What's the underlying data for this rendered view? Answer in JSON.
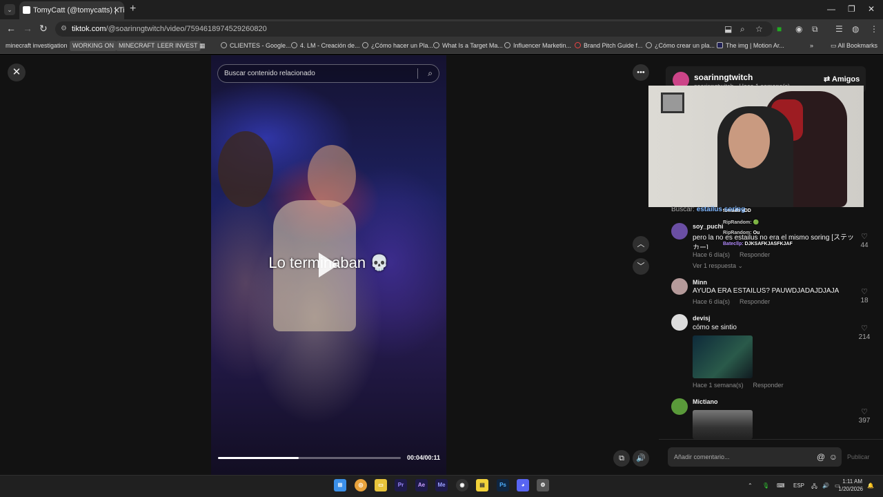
{
  "browser": {
    "tab_title": "TomyCatt (@tomycatts) | TikTok",
    "url_domain": "tiktok.com",
    "url_path": "/@soarinngtwitch/video/7594618974529260820",
    "bookmarks": [
      "minecraft investigation",
      "WORKING ON",
      "MINECRAFT",
      "LEER INVEST",
      "CLIENTES - Google...",
      "4. LM - Creación de...",
      "¿Cómo hacer un Pla...",
      "What Is a Target Ma...",
      "Influencer Marketin...",
      "Brand Pitch Guide f...",
      "¿Cómo crear un pla...",
      "The img | Motion Ar..."
    ],
    "all_bookmarks": "All Bookmarks"
  },
  "video": {
    "search_placeholder": "Buscar contenido relacionado",
    "caption": "Lo terminaban 💀",
    "time": "00:04/00:11",
    "progress_fraction": 0.44
  },
  "author": {
    "name": "soarinngtwitch",
    "sub": "soarinngtwitch · Hace 1 semana(s)",
    "follow": "Amigos"
  },
  "chat_overlay": [
    {
      "user": "",
      "msg": "tomada xDD"
    },
    {
      "user": "RipRandom:",
      "msg": "🟢"
    },
    {
      "user": "RipRandom:",
      "msg": "Ou"
    },
    {
      "user": "Batecllp:",
      "msg": "DJKSAFKJASFKJAF"
    }
  ],
  "search_suggestion": {
    "label": "Buscar:",
    "term": "estailus soring"
  },
  "comments": [
    {
      "user": "soy_puchi",
      "text": "pero la no es estailus no era el mismo soring [ステッカー]",
      "meta": "Hace 6 día(s)",
      "reply": "Responder",
      "likes": "44",
      "more": "Ver 1 respuesta"
    },
    {
      "user": "Minn",
      "text": "AYUDA ERA ESTAILUS? PAUWDJADAJDJAJA",
      "meta": "Hace 6 día(s)",
      "reply": "Responder",
      "likes": "18"
    },
    {
      "user": "devisj",
      "text": "cómo se sintio",
      "meta": "Hace 1 semana(s)",
      "reply": "Responder",
      "likes": "214"
    },
    {
      "user": "Mictiano",
      "text": "",
      "likes": "397"
    }
  ],
  "comment_input": {
    "placeholder": "Añadir comentario...",
    "post": "Publicar"
  },
  "taskbar": {
    "lang": "ESP",
    "time": "1:11 AM",
    "date": "1/20/2026"
  }
}
